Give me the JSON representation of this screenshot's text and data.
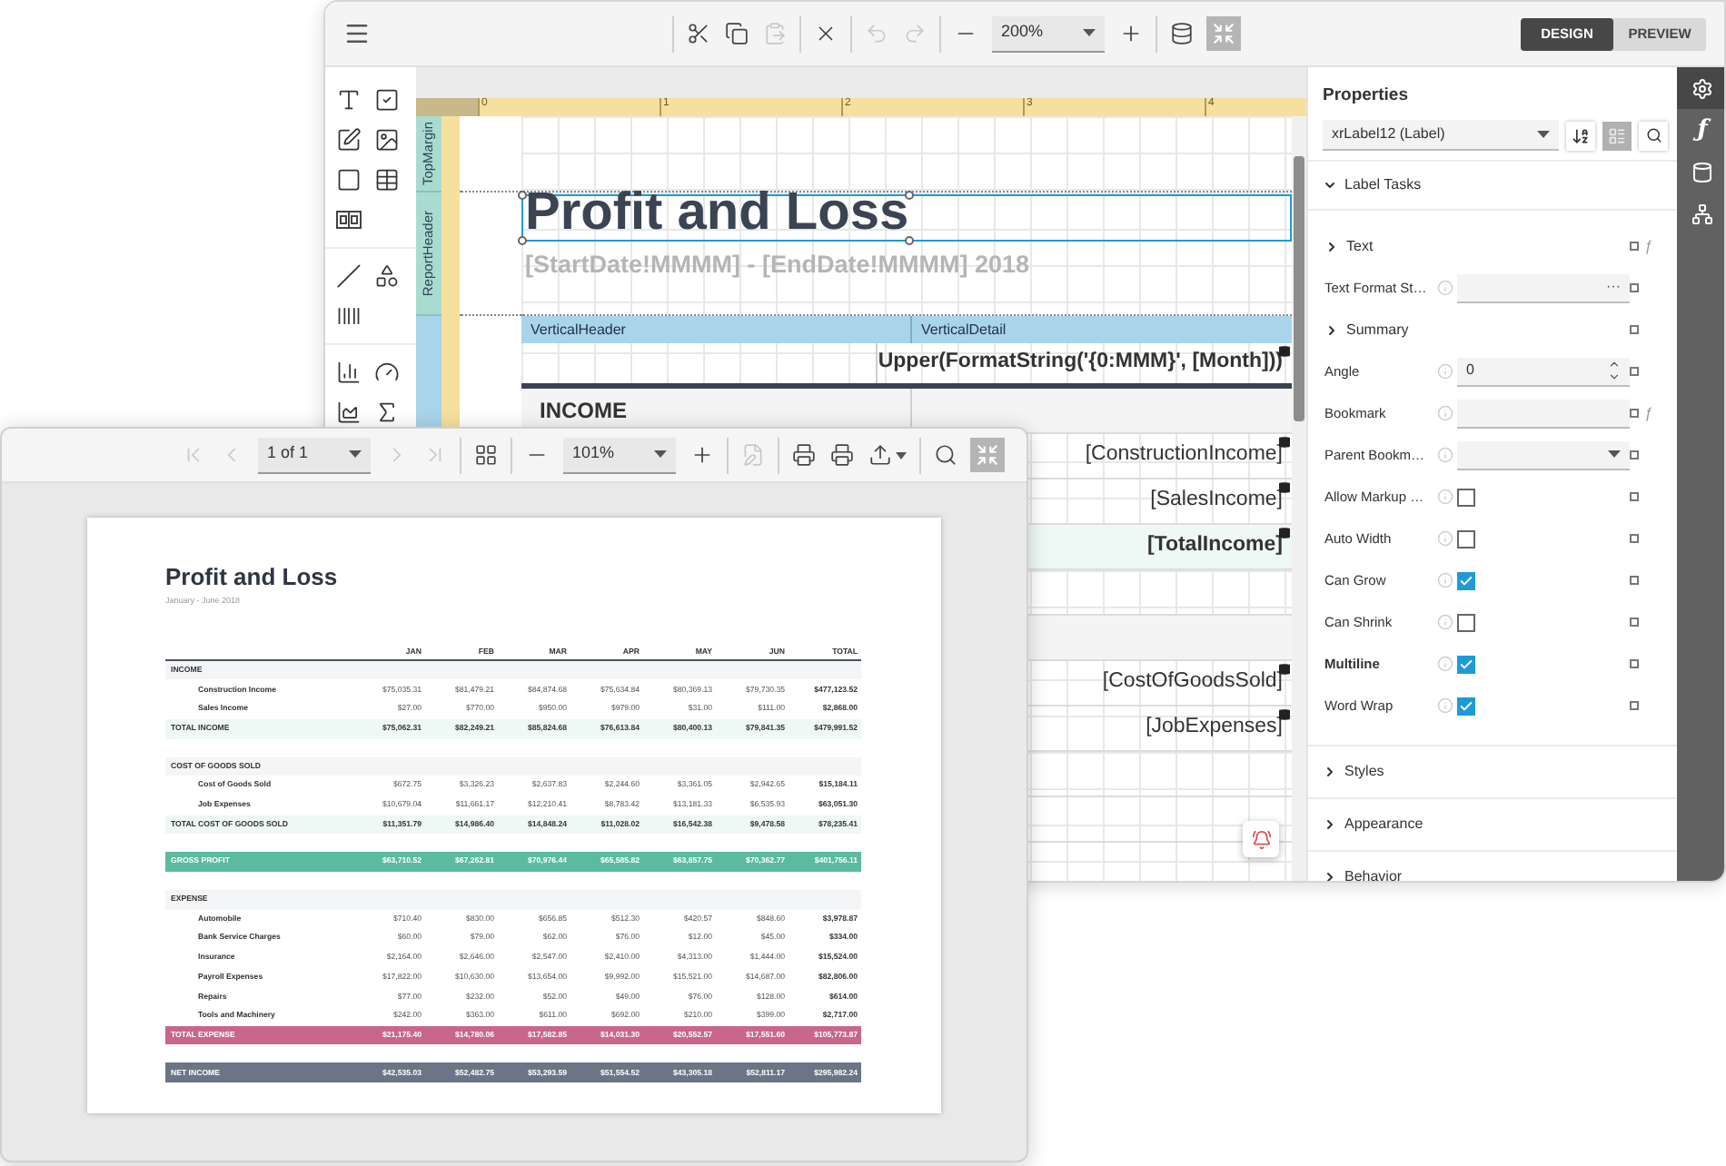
{
  "designer": {
    "toolbar_groups": [
      [
        {
          "kind": "cut",
          "disabled": false
        },
        {
          "kind": "copy",
          "disabled": false
        },
        {
          "kind": "paste",
          "disabled": true
        }
      ],
      [
        {
          "kind": "delete",
          "disabled": false
        }
      ],
      [
        {
          "kind": "undo",
          "disabled": true
        },
        {
          "kind": "redo",
          "disabled": true
        }
      ],
      [
        {
          "kind": "zoom_out",
          "disabled": false
        },
        {
          "kind": "select",
          "value": "200%"
        },
        {
          "kind": "zoom_in",
          "disabled": false
        }
      ],
      [
        {
          "kind": "validate",
          "disabled": false
        },
        {
          "kind": "fullscreen"
        }
      ]
    ],
    "mode_tabs": [
      {
        "label": "DESIGN",
        "selected": true
      },
      {
        "label": "PREVIEW",
        "selected": false
      }
    ],
    "toolbox_groups": [
      [
        {
          "kind": "label"
        },
        {
          "kind": "checkbox"
        },
        {
          "kind": "edit"
        },
        {
          "kind": "picture"
        },
        {
          "kind": "panel"
        },
        {
          "kind": "table"
        },
        {
          "kind": "character_comb"
        }
      ],
      [
        {
          "kind": "line"
        },
        {
          "kind": "shape"
        },
        {
          "kind": "barcode"
        }
      ],
      [
        {
          "kind": "chart"
        },
        {
          "kind": "gauge"
        },
        {
          "kind": "sparkline"
        },
        {
          "kind": "summary"
        }
      ]
    ],
    "ruler_marks": [
      "0",
      "1",
      "2",
      "3",
      "4"
    ],
    "bands": [
      {
        "name": "TopMargin",
        "kind": "margin"
      },
      {
        "name": "ReportHeader",
        "kind": "header"
      }
    ],
    "title": {
      "text": "Profit and Loss",
      "selected": true
    },
    "subtitle": "[StartDate!MMMM] - [EndDate!MMMM] 2018",
    "vertical_band": {
      "captions": [
        "VerticalHeader",
        "VerticalDetail"
      ],
      "rows": [
        {
          "kind": "expression",
          "field": "Upper(FormatString('{0:MMM}', [Month]))"
        },
        {
          "kind": "section",
          "label": "INCOME"
        },
        {
          "kind": "field",
          "field": "[ConstructionIncome]"
        },
        {
          "kind": "field",
          "field": "[SalesIncome]"
        },
        {
          "kind": "total",
          "field": "[TotalIncome]"
        },
        {
          "kind": "blank"
        },
        {
          "kind": "section"
        },
        {
          "kind": "field",
          "field": "[CostOfGoodsSold]"
        },
        {
          "kind": "field",
          "field": "[JobExpenses]"
        },
        {
          "kind": "blank"
        },
        {
          "kind": "blank"
        },
        {
          "kind": "blank"
        }
      ]
    }
  },
  "properties": {
    "title": "Properties",
    "component": "xrLabel12 (Label)",
    "categorized": true,
    "tasks": {
      "label": "Label Tasks",
      "expanded": true
    },
    "rows": [
      {
        "kind": "group",
        "label": "Text",
        "expression": "ƒ"
      },
      {
        "kind": "text",
        "label": "Text Format St…",
        "button": "···"
      },
      {
        "kind": "group",
        "label": "Summary"
      },
      {
        "kind": "spin",
        "label": "Angle",
        "value": "0"
      },
      {
        "kind": "text",
        "label": "Bookmark",
        "expression": "ƒ"
      },
      {
        "kind": "select",
        "label": "Parent Bookm…"
      },
      {
        "kind": "check",
        "label": "Allow Markup …",
        "checked": false,
        "bold": false
      },
      {
        "kind": "check",
        "label": "Auto Width",
        "checked": false,
        "bold": false
      },
      {
        "kind": "check",
        "label": "Can Grow",
        "checked": true,
        "bold": false
      },
      {
        "kind": "check",
        "label": "Can Shrink",
        "checked": false,
        "bold": false
      },
      {
        "kind": "check",
        "label": "Multiline",
        "checked": true,
        "bold": true
      },
      {
        "kind": "check",
        "label": "Word Wrap",
        "checked": true,
        "bold": false
      }
    ],
    "sections": [
      "Styles",
      "Appearance",
      "Behavior"
    ]
  },
  "side_tabs": [
    {
      "kind": "settings",
      "selected": true
    },
    {
      "kind": "function",
      "glyph": "ƒ",
      "selected": false
    },
    {
      "kind": "data",
      "selected": false
    },
    {
      "kind": "tree",
      "selected": false
    }
  ],
  "preview": {
    "toolbar_groups": [
      [
        {
          "kind": "first",
          "disabled": true
        },
        {
          "kind": "prev",
          "disabled": true
        },
        {
          "kind": "select",
          "value": "1 of 1"
        },
        {
          "kind": "next",
          "disabled": true
        },
        {
          "kind": "last",
          "disabled": true
        }
      ],
      [
        {
          "kind": "multipage",
          "disabled": false
        }
      ],
      [
        {
          "kind": "zoom_out",
          "disabled": false
        },
        {
          "kind": "select",
          "value": "101%"
        },
        {
          "kind": "zoom_in",
          "disabled": false
        }
      ],
      [
        {
          "kind": "edit",
          "disabled": true
        }
      ],
      [
        {
          "kind": "print",
          "disabled": false
        },
        {
          "kind": "print_page",
          "disabled": false
        },
        {
          "kind": "export",
          "disabled": false
        }
      ],
      [
        {
          "kind": "search",
          "disabled": false
        },
        {
          "kind": "fullscreen"
        }
      ]
    ],
    "report": {
      "title": "Profit and Loss",
      "subtitle": "January - June 2018",
      "columns": [
        "JAN",
        "FEB",
        "MAR",
        "APR",
        "MAY",
        "JUN",
        "TOTAL"
      ],
      "rows": [
        {
          "kind": "section",
          "label": "INCOME"
        },
        {
          "kind": "item",
          "label": "Construction Income",
          "values": [
            "$75,035.31",
            "$81,479.21",
            "$84,874.68",
            "$75,634.84",
            "$80,369.13",
            "$79,730.35",
            "$477,123.52"
          ]
        },
        {
          "kind": "item",
          "label": "Sales Income",
          "values": [
            "$27.00",
            "$770.00",
            "$950.00",
            "$979.00",
            "$31.00",
            "$111.00",
            "$2,868.00"
          ]
        },
        {
          "kind": "total",
          "label": "TOTAL INCOME",
          "values": [
            "$75,062.31",
            "$82,249.21",
            "$85,824.68",
            "$76,613.84",
            "$80,400.13",
            "$79,841.35",
            "$479,991.52"
          ]
        },
        {
          "kind": "section",
          "label": "COST OF GOODS SOLD"
        },
        {
          "kind": "item",
          "label": "Cost of Goods Sold",
          "values": [
            "$672.75",
            "$3,326.23",
            "$2,637.83",
            "$2,244.60",
            "$3,361.05",
            "$2,942.65",
            "$15,184.11"
          ]
        },
        {
          "kind": "item",
          "label": "Job Expenses",
          "values": [
            "$10,679.04",
            "$11,661.17",
            "$12,210.41",
            "$8,783.42",
            "$13,181.33",
            "$6,535.93",
            "$63,051.30"
          ]
        },
        {
          "kind": "total",
          "label": "TOTAL COST OF GOODS SOLD",
          "values": [
            "$11,351.79",
            "$14,986.40",
            "$14,848.24",
            "$11,028.02",
            "$16,542.38",
            "$9,478.58",
            "$78,235.41"
          ]
        },
        {
          "kind": "summary",
          "label": "GROSS PROFIT",
          "color": "#5bbb9e",
          "values": [
            "$63,710.52",
            "$67,262.81",
            "$70,976.44",
            "$65,585.82",
            "$63,857.75",
            "$70,362.77",
            "$401,756.11"
          ]
        },
        {
          "kind": "section",
          "label": "EXPENSE"
        },
        {
          "kind": "item",
          "label": "Automobile",
          "values": [
            "$710.40",
            "$830.00",
            "$656.85",
            "$512.30",
            "$420.57",
            "$848.60",
            "$3,978.87"
          ]
        },
        {
          "kind": "item",
          "label": "Bank Service Charges",
          "values": [
            "$60.00",
            "$79.00",
            "$62.00",
            "$76.00",
            "$12.00",
            "$45.00",
            "$334.00"
          ]
        },
        {
          "kind": "item",
          "label": "Insurance",
          "values": [
            "$2,164.00",
            "$2,646.00",
            "$2,547.00",
            "$2,410.00",
            "$4,313.00",
            "$1,444.00",
            "$15,524.00"
          ]
        },
        {
          "kind": "item",
          "label": "Payroll Expenses",
          "values": [
            "$17,822.00",
            "$10,630.00",
            "$13,654.00",
            "$9,992.00",
            "$15,521.00",
            "$14,687.00",
            "$82,806.00"
          ]
        },
        {
          "kind": "item",
          "label": "Repairs",
          "values": [
            "$77.00",
            "$232.00",
            "$52.00",
            "$49.00",
            "$76.00",
            "$128.00",
            "$614.00"
          ]
        },
        {
          "kind": "item",
          "label": "Tools and Machinery",
          "values": [
            "$242.00",
            "$363.00",
            "$611.00",
            "$692.00",
            "$210.00",
            "$399.00",
            "$2,717.00"
          ]
        },
        {
          "kind": "total",
          "label": "TOTAL EXPENSE",
          "color": "#c9668b",
          "values": [
            "$21,175.40",
            "$14,780.06",
            "$17,582.85",
            "$14,031.30",
            "$20,552.57",
            "$17,551.60",
            "$105,773.87"
          ]
        },
        {
          "kind": "summary",
          "label": "NET INCOME",
          "color": "#6c7487",
          "values": [
            "$42,535.03",
            "$52,482.75",
            "$53,293.59",
            "$51,554.52",
            "$43,305.18",
            "$52,811.17",
            "$295,982.24"
          ]
        }
      ]
    }
  }
}
